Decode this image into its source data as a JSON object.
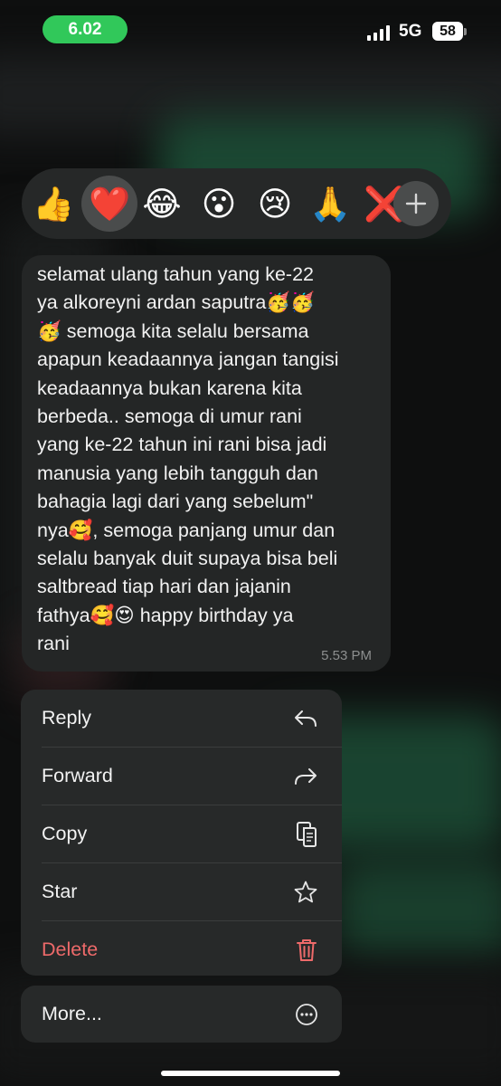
{
  "status_bar": {
    "time": "6.02",
    "network": "5G",
    "battery": "58"
  },
  "reactions": {
    "items": [
      {
        "name": "thumbs-up",
        "glyph": "👍",
        "selected": false
      },
      {
        "name": "red-heart",
        "glyph": "❤️",
        "selected": true
      },
      {
        "name": "tears-of-joy",
        "glyph": "😂",
        "selected": false
      },
      {
        "name": "surprised-face",
        "glyph": "😮",
        "selected": false
      },
      {
        "name": "crying-face",
        "glyph": "😢",
        "selected": false
      },
      {
        "name": "folded-hands",
        "glyph": "🙏",
        "selected": false
      },
      {
        "name": "cross-mark",
        "glyph": "❌",
        "selected": false
      }
    ],
    "more_icon": "plus-icon"
  },
  "message": {
    "text": "selamat ulang tahun yang ke-22\nya alkoreyni ardan saputra🥳🥳\n🥳 semoga kita selalu bersama\napapun keadaannya jangan tangisi\nkeadaannya bukan karena kita\nberbeda.. semoga di umur rani\nyang ke-22 tahun ini rani bisa jadi\nmanusia yang lebih tangguh dan\nbahagia lagi dari yang sebelum\"\nnya🥰, semoga panjang umur dan\nselalu banyak duit supaya bisa beli\nsaltbread tiap hari dan jajanin\nfathya🥰😍 happy birthday ya\nrani",
    "time": "5.53 PM"
  },
  "menu": {
    "items": [
      {
        "label": "Reply",
        "icon": "reply-icon"
      },
      {
        "label": "Forward",
        "icon": "forward-icon"
      },
      {
        "label": "Copy",
        "icon": "copy-icon"
      },
      {
        "label": "Star",
        "icon": "star-icon"
      },
      {
        "label": "Delete",
        "icon": "trash-icon",
        "color": "#ee6a6a"
      }
    ],
    "more": {
      "label": "More...",
      "icon": "more-icon"
    }
  },
  "colors": {
    "status_pill": "#31c85a",
    "delete": "#ee6a6a",
    "bubble": "#242626"
  }
}
